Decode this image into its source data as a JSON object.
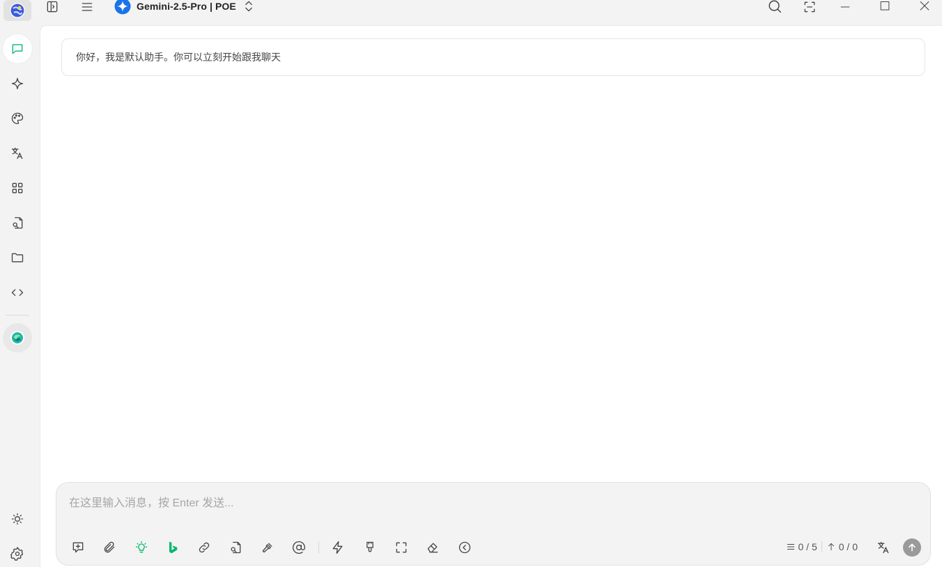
{
  "app": {
    "model_name": "Gemini-2.5-Pro | POE"
  },
  "sidebar": {
    "items": [
      {
        "id": "chat",
        "icon": "chat-bubble-icon",
        "active": true
      },
      {
        "id": "agents",
        "icon": "sparkle-icon",
        "active": false
      },
      {
        "id": "paint",
        "icon": "palette-icon",
        "active": false
      },
      {
        "id": "translate",
        "icon": "translate-icon",
        "active": false
      },
      {
        "id": "apps",
        "icon": "grid-icon",
        "active": false
      },
      {
        "id": "files",
        "icon": "file-search-icon",
        "active": false
      },
      {
        "id": "folders",
        "icon": "folder-icon",
        "active": false
      },
      {
        "id": "code",
        "icon": "code-icon",
        "active": false
      }
    ],
    "bottom": [
      "theme-sun-icon",
      "settings-gear-icon"
    ]
  },
  "chat": {
    "welcome_message": "你好，我是默认助手。你可以立刻开始跟我聊天"
  },
  "composer": {
    "placeholder": "在这里输入消息，按 Enter 发送...",
    "value": "",
    "context_count": "0 / 5",
    "token_count": "0 / 0"
  },
  "colors": {
    "accent": "#00b96b",
    "gemini_blue": "#1a73e8",
    "send_button": "#9a9a9a"
  }
}
